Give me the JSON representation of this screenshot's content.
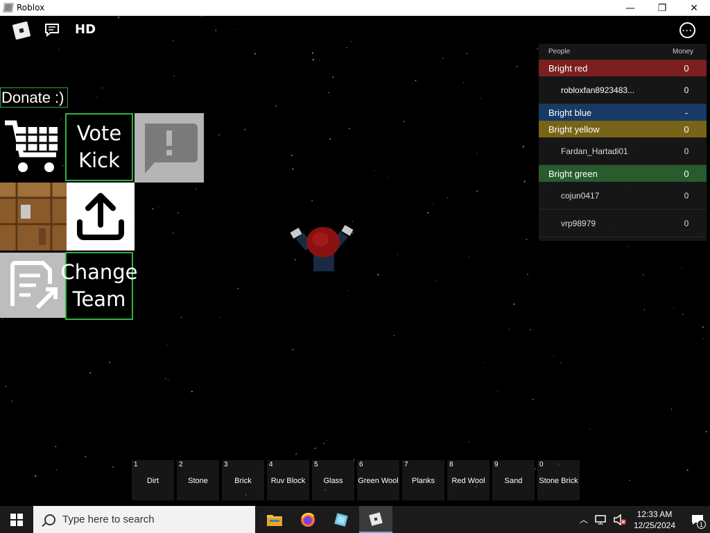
{
  "window": {
    "title": "Roblox",
    "minimize": "—",
    "restore": "❐",
    "close": "✕"
  },
  "topbar": {
    "hd_label": "HD",
    "menu_label": "···"
  },
  "leaderboard": {
    "col_people": "People",
    "col_money": "Money",
    "teams": [
      {
        "name": "Bright red",
        "value": "0",
        "color": "#7b1f1f"
      },
      {
        "name": "Bright blue",
        "value": "-",
        "color": "#173a66"
      },
      {
        "name": "Bright yellow",
        "value": "0",
        "color": "#786418"
      },
      {
        "name": "Bright green",
        "value": "0",
        "color": "#285b2e"
      }
    ],
    "players": [
      {
        "name": "robloxfan8923483...",
        "value": "0"
      },
      {
        "name": "Fardan_Hartadi01",
        "value": "0"
      },
      {
        "name": "cojun0417",
        "value": "0"
      },
      {
        "name": "vrp98979",
        "value": "0"
      }
    ]
  },
  "panel": {
    "donate_label": "Donate :)",
    "vote_kick_label": "Vote\nKick",
    "change_team_label": "Change\nTeam"
  },
  "hotbar": [
    {
      "num": "1",
      "name": "Dirt"
    },
    {
      "num": "2",
      "name": "Stone"
    },
    {
      "num": "3",
      "name": "Brick"
    },
    {
      "num": "4",
      "name": "Ruv Block"
    },
    {
      "num": "5",
      "name": "Glass"
    },
    {
      "num": "6",
      "name": "Green Wool"
    },
    {
      "num": "7",
      "name": "Planks"
    },
    {
      "num": "8",
      "name": "Red Wool"
    },
    {
      "num": "9",
      "name": "Sand"
    },
    {
      "num": "0",
      "name": "Stone Brick"
    }
  ],
  "taskbar": {
    "search_placeholder": "Type here to search",
    "time": "12:33 AM",
    "date": "12/25/2024",
    "notification_count": "1"
  },
  "colors": {
    "accent_green": "#2fb344",
    "taskbar_bg": "#1b1b1b"
  }
}
